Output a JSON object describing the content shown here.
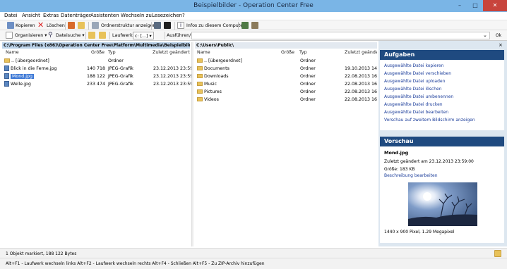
{
  "window": {
    "title": "Beispielbilder - Operation Center Free",
    "minimize": "–",
    "maximize": "□",
    "close": "✕"
  },
  "menu": [
    "Datei",
    "Ansicht",
    "Extras",
    "Datenträger",
    "Assistenten",
    "Wechseln zu",
    "Lesezeichen",
    "?"
  ],
  "toolbar1": {
    "copy": "Kopieren",
    "delete": "Löschen",
    "folder_structure": "Ordnerstruktur anzeigen",
    "computer_info": "Infos zu diesem Computer"
  },
  "toolbar2": {
    "organize": "Organisieren ▾",
    "file_search": "Dateisuche ▾",
    "drive_label": "Laufwerk:",
    "drive_value": "c: [...] ▾",
    "run_label": "Ausführen/ www:",
    "run_value": "",
    "ok": "Ok"
  },
  "left_pane": {
    "path": "C:\\Program Files (x86)\\Operation Center Free\\Platform\\Multimedia\\Beispielbilder\\",
    "columns": {
      "name": "Name",
      "size": "Größe",
      "type": "Typ",
      "modified": "Zuletzt geändert"
    },
    "rows": [
      {
        "icon": "folder-up",
        "name": ".. [übergeordnet]",
        "size": "",
        "type": "Ordner",
        "modified": ""
      },
      {
        "icon": "jpg",
        "name": "Blick in die Ferne.jpg",
        "size": "140 718",
        "type": "JPEG-Grafik",
        "modified": "23.12.2013 23:59"
      },
      {
        "icon": "jpg",
        "name": "Mond.jpg",
        "size": "188 122",
        "type": "JPEG-Grafik",
        "modified": "23.12.2013 23:59",
        "selected": true
      },
      {
        "icon": "jpg",
        "name": "Welle.jpg",
        "size": "233 474",
        "type": "JPEG-Grafik",
        "modified": "23.12.2013 23:59"
      }
    ]
  },
  "right_pane": {
    "path": "C:\\Users\\Public\\",
    "columns": {
      "name": "Name",
      "size": "Größe",
      "type": "Typ",
      "modified": "Zuletzt geänder"
    },
    "rows": [
      {
        "icon": "folder-up",
        "name": ".. [übergeordnet]",
        "size": "",
        "type": "Ordner",
        "modified": ""
      },
      {
        "icon": "folder",
        "name": "Documents",
        "size": "",
        "type": "Ordner",
        "modified": "19.10.2013 14:53"
      },
      {
        "icon": "folder",
        "name": "Downloads",
        "size": "",
        "type": "Ordner",
        "modified": "22.08.2013 16:36"
      },
      {
        "icon": "folder",
        "name": "Music",
        "size": "",
        "type": "Ordner",
        "modified": "22.08.2013 16:36"
      },
      {
        "icon": "folder",
        "name": "Pictures",
        "size": "",
        "type": "Ordner",
        "modified": "22.08.2013 16:36"
      },
      {
        "icon": "folder",
        "name": "Videos",
        "size": "",
        "type": "Ordner",
        "modified": "22.08.2013 16:36"
      }
    ]
  },
  "tasks": {
    "title": "Aufgaben",
    "items": [
      "Ausgewählte Datei kopieren",
      "Ausgewählte Datei verschieben",
      "Ausgewählte Datei uploaden",
      "Ausgewählte Datei löschen",
      "Ausgewählte Datei umbenennen",
      "Ausgewählte Datei drucken",
      "Ausgewählte Datei bearbeiten",
      "Vorschau auf zweitem Bildschirm anzeigen"
    ]
  },
  "preview": {
    "title": "Vorschau",
    "filename": "Mond.jpg",
    "modified": "Zuletzt geändert am 23.12.2013 23:59:00",
    "size": "Größe: 183 KB",
    "edit_link": "Beschreibung bearbeiten",
    "dimensions": "1440 x 900 Pixel, 1.29 Megapixel"
  },
  "panel_close": "×",
  "status": {
    "line1": "1 Objekt markiert, 188 122 Bytes",
    "line2": "Alt+F1 - Laufwerk wechseln links   Alt+F2 - Laufwerk wechseln rechts   Alt+F4 - Schließen   Alt+F5 - Zu ZIP-Archiv hinzufügen"
  },
  "colors": {
    "titlebar": "#7ab5e6",
    "panel_header": "#1f4a80",
    "selection": "#3d79d6",
    "link": "#1a3c9a"
  }
}
